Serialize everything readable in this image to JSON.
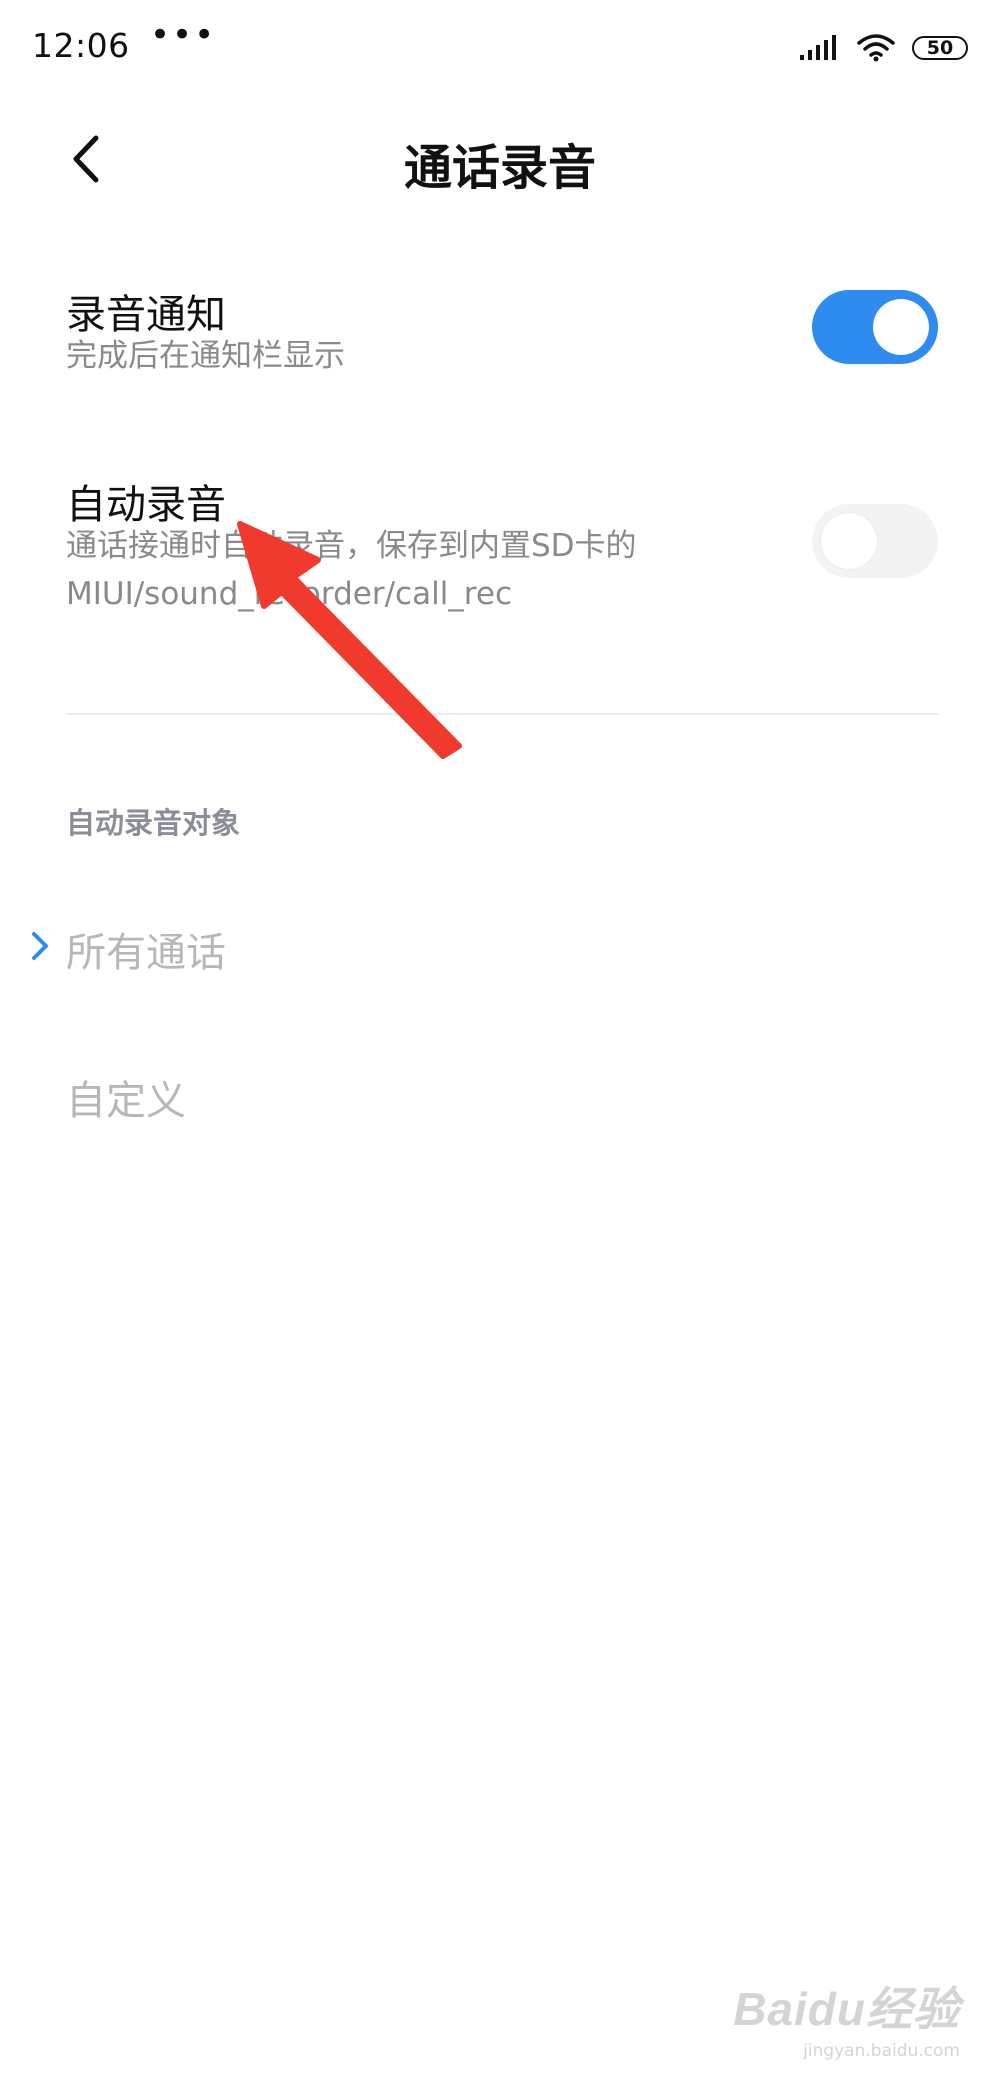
{
  "status_bar": {
    "time": "12:06",
    "overflow_dots": "•••",
    "battery": "50",
    "icons": [
      "signal-icon",
      "wifi-icon",
      "battery-icon"
    ]
  },
  "header": {
    "title": "通话录音",
    "back_icon": "chevron-left-icon"
  },
  "settings": {
    "record_notification": {
      "title": "录音通知",
      "description": "完成后在通知栏显示",
      "enabled": true
    },
    "auto_record": {
      "title": "自动录音",
      "description": "通话接通时自动录音，保存到内置SD卡的MIUI/sound_recorder/call_rec",
      "enabled": false
    }
  },
  "auto_record_targets": {
    "header": "自动录音对象",
    "options": [
      {
        "label": "所有通话",
        "selected": true
      },
      {
        "label": "自定义",
        "selected": false
      }
    ]
  },
  "watermark": {
    "logo_text": "Baidu经验",
    "url": "jingyan.baidu.com"
  },
  "colors": {
    "accent": "#2e8cf0",
    "annotation_arrow": "#f03a2e",
    "secondary_text": "#8a8a8a",
    "disabled_text": "#b7b7b7"
  }
}
